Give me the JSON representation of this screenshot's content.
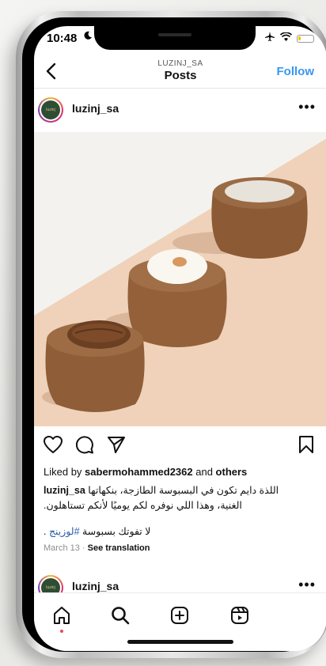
{
  "status_bar": {
    "time": "10:48"
  },
  "header": {
    "account": "LUZINJ_SA",
    "title": "Posts",
    "follow_label": "Follow"
  },
  "post": {
    "username": "luzinj_sa",
    "avatar_text": "luzinj",
    "liked_by_prefix": "Liked by ",
    "liked_by_user": "sabermohammed2362",
    "liked_by_and": " and ",
    "liked_by_others": "others",
    "caption_user": "luzinj_sa",
    "caption_line1": "اللذة دايم تكون في البسبوسة الطازجة، بنكهاتها",
    "caption_line2": "الغنية، وهذا اللي نوفره لكم يوميًا لأنكم تستاهلون.",
    "caption_line3_text": ". لا تفوتك بسبوسة ",
    "hashtag": "#لوزينج",
    "date": "March 13",
    "separator": " · ",
    "translation": "See translation"
  },
  "next_post": {
    "username": "luzinj_sa",
    "avatar_text": "luzinj"
  },
  "colors": {
    "accent": "#3897f0",
    "hashtag": "#2a5ba8",
    "notification_dot": "#ed4956",
    "image_bg": "#efd3bc"
  },
  "icons": [
    "chevron-left-icon",
    "more-icon",
    "heart-icon",
    "comment-icon",
    "share-icon",
    "bookmark-icon",
    "home-icon",
    "search-icon",
    "create-icon",
    "reels-icon",
    "airplane-icon",
    "wifi-icon",
    "battery-icon",
    "moon-icon"
  ]
}
